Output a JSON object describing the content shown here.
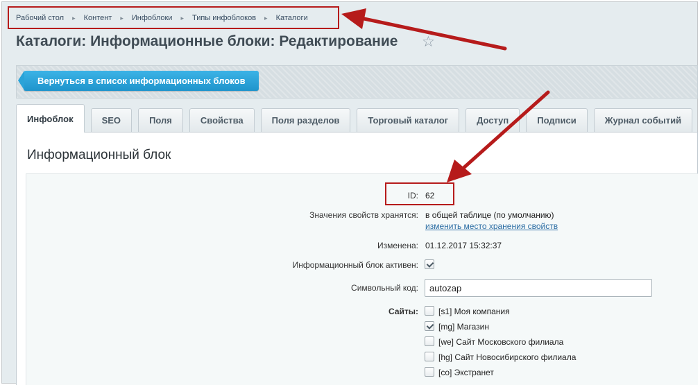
{
  "breadcrumb": {
    "items": [
      "Рабочий стол",
      "Контент",
      "Инфоблоки",
      "Типы инфоблоков",
      "Каталоги"
    ],
    "separator": "▸"
  },
  "header": {
    "title": "Каталоги: Информационные блоки: Редактирование",
    "favorite_icon": "star-icon"
  },
  "toolbar": {
    "back_label": "Вернуться в список информационных блоков"
  },
  "tabs": [
    {
      "label": "Инфоблок",
      "active": true
    },
    {
      "label": "SEO",
      "active": false
    },
    {
      "label": "Поля",
      "active": false
    },
    {
      "label": "Свойства",
      "active": false
    },
    {
      "label": "Поля разделов",
      "active": false
    },
    {
      "label": "Торговый каталог",
      "active": false
    },
    {
      "label": "Доступ",
      "active": false
    },
    {
      "label": "Подписи",
      "active": false
    },
    {
      "label": "Журнал событий",
      "active": false
    }
  ],
  "section": {
    "title": "Информационный блок"
  },
  "form": {
    "id_label": "ID:",
    "id_value": "62",
    "storage_label": "Значения свойств хранятся:",
    "storage_value": "в общей таблице (по умолчанию)",
    "storage_link": "изменить место хранения свойств",
    "modified_label": "Изменена:",
    "modified_value": "01.12.2017 15:32:37",
    "active_label": "Информационный блок активен:",
    "active_checked": true,
    "code_label": "Символьный код:",
    "code_value": "autozap",
    "sites_label": "Сайты:",
    "sites": [
      {
        "label": "[s1] Моя компания",
        "checked": false
      },
      {
        "label": "[mg] Магазин",
        "checked": true
      },
      {
        "label": "[we] Сайт Московского филиала",
        "checked": false
      },
      {
        "label": "[hg] Сайт Новосибирского филиала",
        "checked": false
      },
      {
        "label": "[co] Экстранет",
        "checked": false
      }
    ]
  },
  "colors": {
    "annotation": "#b61b1b",
    "button_blue": "#1f94cc",
    "link": "#2d6ea4"
  }
}
